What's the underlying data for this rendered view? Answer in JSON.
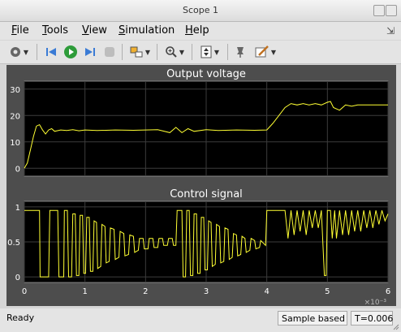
{
  "window": {
    "title": "Scope 1"
  },
  "menu": [
    {
      "key": "F",
      "rest": "ile"
    },
    {
      "key": "T",
      "rest": "ools"
    },
    {
      "key": "V",
      "rest": "iew"
    },
    {
      "key": "S",
      "rest": "imulation"
    },
    {
      "key": "H",
      "rest": "elp"
    }
  ],
  "status": {
    "ready": "Ready",
    "mode": "Sample based",
    "time": "T=0.006"
  },
  "chart_data": [
    {
      "type": "line",
      "title": "Output voltage",
      "ylim": [
        -3,
        33
      ],
      "yticks": [
        0,
        10,
        20,
        30
      ],
      "xlim": [
        0,
        6
      ],
      "grid": true,
      "x": [
        0,
        0.05,
        0.1,
        0.15,
        0.2,
        0.25,
        0.3,
        0.35,
        0.4,
        0.45,
        0.5,
        0.6,
        0.7,
        0.8,
        0.9,
        1.0,
        1.2,
        1.5,
        1.8,
        2.0,
        2.2,
        2.4,
        2.5,
        2.6,
        2.7,
        2.8,
        3.0,
        3.2,
        3.5,
        3.8,
        4.0,
        4.1,
        4.2,
        4.3,
        4.4,
        4.5,
        4.6,
        4.7,
        4.8,
        4.9,
        5.0,
        5.05,
        5.1,
        5.2,
        5.3,
        5.4,
        5.5,
        5.7,
        6.0
      ],
      "y": [
        0,
        2,
        7,
        12,
        16,
        16.5,
        14.5,
        13,
        14.5,
        15,
        14,
        14.5,
        14.3,
        14.6,
        14.2,
        14.5,
        14.3,
        14.5,
        14.4,
        14.5,
        14.6,
        13.5,
        15.5,
        13.5,
        15,
        14,
        14.6,
        14.3,
        14.5,
        14.4,
        14.5,
        17,
        20,
        23,
        24.5,
        24,
        24.5,
        24,
        24.5,
        24,
        25,
        25.3,
        23,
        22,
        24,
        23.5,
        24,
        24,
        24
      ]
    },
    {
      "type": "line",
      "title": "Control signal",
      "ylim": [
        -0.08,
        1.08
      ],
      "yticks": [
        0,
        0.5,
        1
      ],
      "ytick_labels": [
        "0",
        "0.5",
        "1"
      ],
      "xlim": [
        0,
        6
      ],
      "xticks": [
        0,
        1,
        2,
        3,
        4,
        5,
        6
      ],
      "x_multiplier": "×10⁻³",
      "grid": true,
      "x": [
        0,
        0.02,
        0.03,
        0.25,
        0.26,
        0.4,
        0.42,
        0.55,
        0.57,
        0.65,
        0.66,
        0.71,
        0.73,
        0.78,
        0.8,
        0.84,
        0.86,
        0.9,
        0.92,
        0.96,
        0.98,
        1.01,
        1.03,
        1.07,
        1.09,
        1.13,
        1.15,
        1.19,
        1.21,
        1.26,
        1.28,
        1.33,
        1.35,
        1.4,
        1.42,
        1.48,
        1.5,
        1.56,
        1.58,
        1.64,
        1.66,
        1.72,
        1.74,
        1.8,
        1.82,
        1.88,
        1.9,
        1.96,
        1.98,
        2.04,
        2.06,
        2.12,
        2.14,
        2.2,
        2.22,
        2.28,
        2.3,
        2.36,
        2.38,
        2.44,
        2.46,
        2.5,
        2.52,
        2.6,
        2.62,
        2.66,
        2.68,
        2.72,
        2.74,
        2.78,
        2.8,
        2.84,
        2.86,
        2.9,
        2.92,
        2.96,
        2.98,
        3.02,
        3.04,
        3.08,
        3.1,
        3.15,
        3.17,
        3.22,
        3.24,
        3.29,
        3.31,
        3.36,
        3.38,
        3.43,
        3.45,
        3.5,
        3.52,
        3.57,
        3.59,
        3.64,
        3.66,
        3.72,
        3.74,
        3.8,
        3.82,
        3.88,
        3.9,
        3.98,
        4.0,
        4.3,
        4.35,
        4.4,
        4.45,
        4.5,
        4.55,
        4.6,
        4.65,
        4.7,
        4.75,
        4.8,
        4.85,
        4.9,
        4.95,
        4.98,
        5.0,
        5.05,
        5.08,
        5.12,
        5.15,
        5.2,
        5.25,
        5.3,
        5.35,
        5.4,
        5.45,
        5.5,
        5.55,
        5.6,
        5.65,
        5.7,
        5.75,
        5.8,
        5.85,
        5.9,
        5.95,
        6.0
      ],
      "y": [
        0.95,
        0.95,
        0.95,
        0.95,
        0.0,
        0.0,
        0.95,
        0.95,
        0.0,
        0.0,
        0.95,
        0.95,
        0.0,
        0.0,
        0.9,
        0.9,
        0.02,
        0.02,
        0.88,
        0.88,
        0.05,
        0.05,
        0.85,
        0.85,
        0.08,
        0.08,
        0.8,
        0.78,
        0.12,
        0.15,
        0.75,
        0.72,
        0.2,
        0.22,
        0.7,
        0.68,
        0.25,
        0.28,
        0.65,
        0.62,
        0.3,
        0.32,
        0.6,
        0.58,
        0.35,
        0.38,
        0.55,
        0.55,
        0.4,
        0.4,
        0.55,
        0.55,
        0.42,
        0.42,
        0.55,
        0.55,
        0.45,
        0.45,
        0.55,
        0.55,
        0.45,
        0.45,
        0.95,
        0.95,
        0.0,
        0.0,
        0.95,
        0.95,
        0.02,
        0.02,
        0.9,
        0.9,
        0.05,
        0.05,
        0.85,
        0.85,
        0.1,
        0.1,
        0.8,
        0.78,
        0.15,
        0.18,
        0.75,
        0.72,
        0.2,
        0.22,
        0.7,
        0.68,
        0.25,
        0.28,
        0.62,
        0.6,
        0.3,
        0.32,
        0.58,
        0.55,
        0.35,
        0.38,
        0.55,
        0.52,
        0.4,
        0.42,
        0.52,
        0.45,
        0.95,
        0.95,
        0.55,
        0.95,
        0.6,
        0.95,
        0.65,
        0.95,
        0.6,
        0.95,
        0.7,
        0.95,
        0.7,
        0.95,
        0.02,
        0.02,
        0.95,
        0.95,
        0.55,
        0.95,
        0.55,
        0.95,
        0.6,
        0.95,
        0.6,
        0.95,
        0.65,
        0.95,
        0.65,
        0.95,
        0.7,
        0.95,
        0.7,
        0.95,
        0.75,
        0.95,
        0.8,
        0.9
      ]
    }
  ]
}
